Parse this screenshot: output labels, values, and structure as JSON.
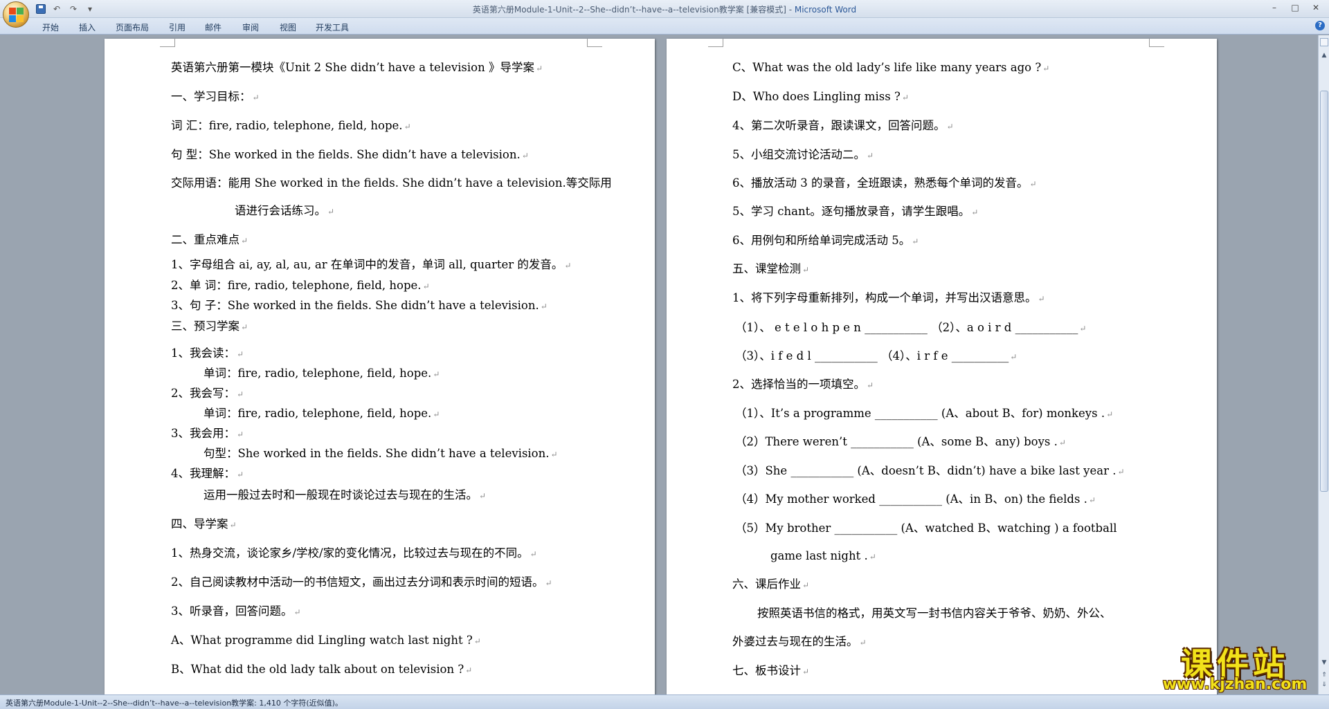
{
  "window": {
    "title": "英语第六册Module-1-Unit--2--She--didn’t--have--a--television教学案 [兼容模式] - ",
    "app_name": "Microsoft Word",
    "controls": [
      "–",
      "□",
      "✕"
    ]
  },
  "qat": {
    "undo": "↶",
    "redo": "↷",
    "customize": "▾"
  },
  "ribbon": {
    "tabs": [
      "开始",
      "插入",
      "页面布局",
      "引用",
      "邮件",
      "审阅",
      "视图",
      "开发工具"
    ],
    "help": "?"
  },
  "pilcrow": "↵",
  "left_page": {
    "lines": [
      "英语第六册第一模块《Unit  2  She  didn’t  have  a  television  》导学案",
      "一、学习目标：",
      "词        汇：fire, radio, telephone, field, hope.",
      "句        型：She worked in the fields. She didn’t have a television.",
      "交际用语：能用 She worked in the fields. She didn’t have a television.等交际用",
      "语进行会话练习。",
      "二、重点难点",
      "1、字母组合 ai, ay, al, au, ar 在单词中的发音，单词 all, quarter 的发音。",
      "2、单        词：fire, radio, telephone, field, hope.",
      "3、句        子：She worked in the fields. She didn’t have a television.",
      "三、预习学案",
      "1、我会读：",
      "单词：fire, radio, telephone, field, hope.",
      "2、我会写：",
      "单词：fire, radio, telephone, field, hope.",
      "3、我会用：",
      "句型：She worked in the fields. She didn’t have a television.",
      "4、我理解：",
      "运用一般过去时和一般现在时谈论过去与现在的生活。",
      "四、导学案",
      "1、热身交流，谈论家乡/学校/家的变化情况，比较过去与现在的不同。",
      "2、自己阅读教材中活动一的书信短文，画出过去分词和表示时间的短语。",
      "3、听录音，回答问题。",
      "A、What  programme  did  Lingling  watch  last  night ?",
      "B、What  did  the  old  lady  talk  about  on  television ?"
    ]
  },
  "right_page": {
    "lines": [
      "C、What  was  the  old  lady’s  life  like  many  years  ago ?",
      "D、Who  does  Lingling  miss ?",
      "4、第二次听录音，跟读课文，回答问题。",
      "5、小组交流讨论活动二。",
      "6、播放活动 3 的录音，全班跟读，熟悉每个单词的发音。",
      "5、学习 chant。逐句播放录音，请学生跟唱。",
      "6、用例句和所给单词完成活动 5。",
      "五、课堂检测",
      "1、将下列字母重新排列，构成一个单词，并写出汉语意思。",
      "（1）、 e t e l o h p e n  ___________ （2）、a o i r d  ___________",
      "（3）、i f e d l          ___________        （4）、i r f e  __________",
      "2、选择恰当的一项填空。",
      "（1）、It’s   a   programme   ___________  (A、about B、for) monkeys .",
      "（2）There   weren’t ___________   (A、some B、any)   boys .",
      "（3）She   ___________  (A、doesn’t B、didn’t) have   a   bike   last   year .",
      "（4）My   mother   worked ___________   (A、in B、on) the   fields .",
      "（5）My   brother   ___________   (A、watched  B、watching  )  a   football",
      "game   last   night .",
      "六、课后作业",
      "按照英语书信的格式，用英文写一封书信内容关于爷爷、奶奶、外公、",
      "外婆过去与现在的生活。",
      "七、板书设计"
    ]
  },
  "status_bar": {
    "text": "英语第六册Module-1-Unit--2--She--didn’t--have--a--television教学案: 1,410 个字符(近似值)。"
  },
  "watermark": {
    "title": "课件站",
    "url": "www.kjzhan.com"
  },
  "colors": {
    "workspace": "#9aa4b0",
    "ribbon": "#cfdcee",
    "app_name": "#2b5797",
    "watermark": "#f2e21a"
  }
}
